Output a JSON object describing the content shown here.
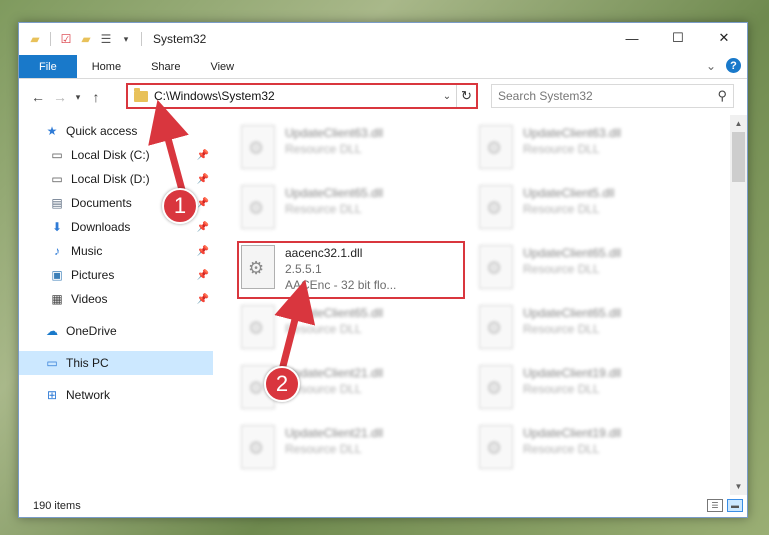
{
  "window": {
    "title": "System32",
    "controls": {
      "minimize": "—",
      "maximize": "☐",
      "close": "✕"
    }
  },
  "ribbon": {
    "tabs": [
      "File",
      "Home",
      "Share",
      "View"
    ],
    "expand": "⌄",
    "help": "?"
  },
  "address": {
    "path": "C:\\Windows\\System32",
    "search_placeholder": "Search System32"
  },
  "nav": {
    "quick_access": "Quick access",
    "items": [
      {
        "label": "Local Disk (C:)",
        "icon": "drive-icon"
      },
      {
        "label": "Local Disk (D:)",
        "icon": "drive-icon"
      },
      {
        "label": "Documents",
        "icon": "documents-icon"
      },
      {
        "label": "Downloads",
        "icon": "downloads-icon"
      },
      {
        "label": "Music",
        "icon": "music-icon"
      },
      {
        "label": "Pictures",
        "icon": "pictures-icon"
      },
      {
        "label": "Videos",
        "icon": "videos-icon"
      }
    ],
    "onedrive": "OneDrive",
    "this_pc": "This PC",
    "network": "Network"
  },
  "files": {
    "highlighted": {
      "name": "aacenc32.1.dll",
      "version": "2.5.5.1",
      "description": "AACEnc - 32 bit flo..."
    },
    "blurred": [
      {
        "name": "UpdateClient63.dll",
        "type": "Resource DLL"
      },
      {
        "name": "UpdateClient63.dll",
        "type": "Resource DLL"
      },
      {
        "name": "UpdateClient65.dll",
        "type": "Resource DLL"
      },
      {
        "name": "UpdateClient5.dll",
        "type": "Resource DLL"
      },
      {
        "name": "UpdateClient65.dll",
        "type": "Resource DLL"
      },
      {
        "name": "UpdateClient65.dll",
        "type": "Resource DLL"
      },
      {
        "name": "UpdateClient65.dll",
        "type": "Resource DLL"
      },
      {
        "name": "UpdateClient21.dll",
        "type": "Resource DLL"
      },
      {
        "name": "UpdateClient19.dll",
        "type": "Resource DLL"
      },
      {
        "name": "UpdateClient21.dll",
        "type": "Resource DLL"
      },
      {
        "name": "UpdateClient19.dll",
        "type": "Resource DLL"
      }
    ]
  },
  "status": {
    "item_count": "190 items"
  },
  "annotations": {
    "step1": "1",
    "step2": "2",
    "color": "#d9363e"
  }
}
